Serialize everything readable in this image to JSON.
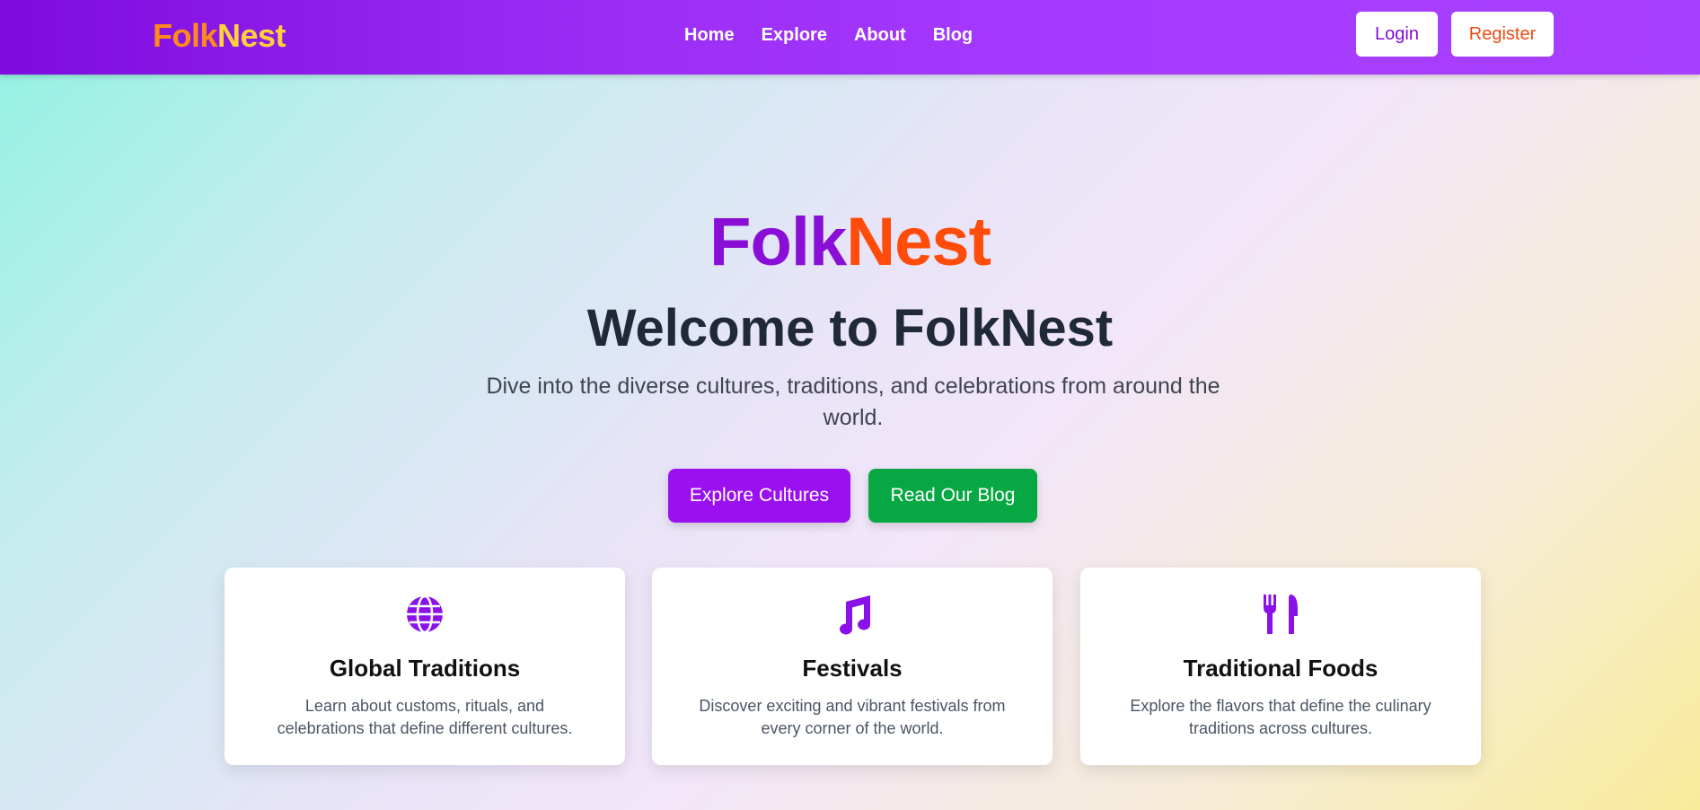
{
  "header": {
    "brand_part1": "Folk",
    "brand_part2": "Nest",
    "nav": [
      {
        "label": "Home"
      },
      {
        "label": "Explore"
      },
      {
        "label": "About"
      },
      {
        "label": "Blog"
      }
    ],
    "login_label": "Login",
    "register_label": "Register"
  },
  "hero": {
    "logo_part1": "Folk",
    "logo_part2": "Nest",
    "title": "Welcome to FolkNest",
    "subtitle": "Dive into the diverse cultures, traditions, and celebrations from around the world.",
    "explore_button": "Explore Cultures",
    "blog_button": "Read Our Blog"
  },
  "cards": [
    {
      "icon": "globe-icon",
      "title": "Global Traditions",
      "description": "Learn about customs, rituals, and celebrations that define different cultures."
    },
    {
      "icon": "music-icon",
      "title": "Festivals",
      "description": "Discover exciting and vibrant festivals from every corner of the world."
    },
    {
      "icon": "utensils-icon",
      "title": "Traditional Foods",
      "description": "Explore the flavors that define the culinary traditions across cultures."
    }
  ],
  "colors": {
    "header_gradient_start": "#7f0bdf",
    "header_gradient_end": "#a73fff",
    "brand_orange": "#ff8a1c",
    "brand_yellow": "#ffd13a",
    "logo_purple": "#8a0fd6",
    "logo_orange": "#ff4c0a",
    "explore_button": "#9b10f0",
    "blog_button": "#07a843",
    "icon_purple": "#8a12e8"
  }
}
